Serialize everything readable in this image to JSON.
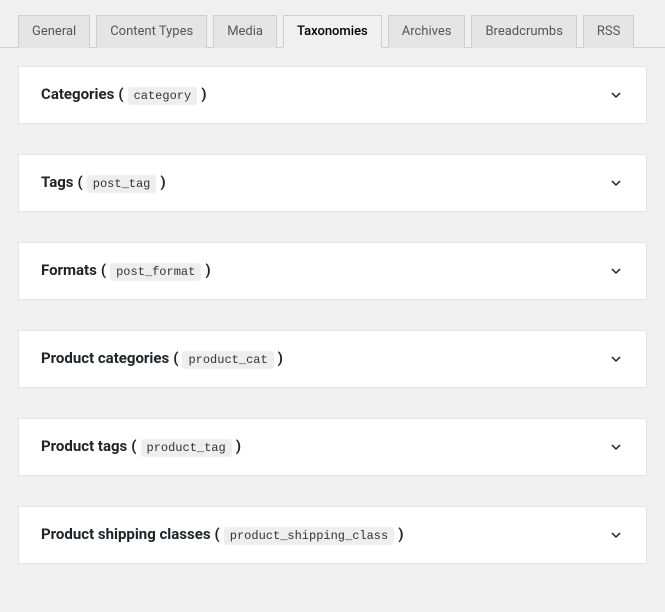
{
  "tabs": [
    {
      "label": "General",
      "active": false
    },
    {
      "label": "Content Types",
      "active": false
    },
    {
      "label": "Media",
      "active": false
    },
    {
      "label": "Taxonomies",
      "active": true
    },
    {
      "label": "Archives",
      "active": false
    },
    {
      "label": "Breadcrumbs",
      "active": false
    },
    {
      "label": "RSS",
      "active": false
    }
  ],
  "panels": [
    {
      "title": "Categories",
      "slug": "category"
    },
    {
      "title": "Tags",
      "slug": "post_tag"
    },
    {
      "title": "Formats",
      "slug": "post_format"
    },
    {
      "title": "Product categories",
      "slug": "product_cat"
    },
    {
      "title": "Product tags",
      "slug": "product_tag"
    },
    {
      "title": "Product shipping classes",
      "slug": "product_shipping_class"
    }
  ]
}
